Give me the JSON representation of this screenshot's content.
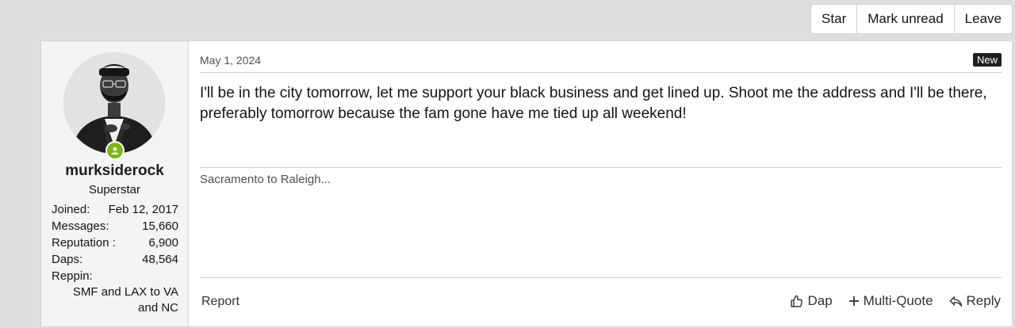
{
  "thread_actions": {
    "star": "Star",
    "mark_unread": "Mark unread",
    "leave": "Leave"
  },
  "user": {
    "username": "murksiderock",
    "title": "Superstar",
    "online": true,
    "stats": [
      {
        "label": "Joined:",
        "value": "Feb 12, 2017"
      },
      {
        "label": "Messages:",
        "value": "15,660"
      },
      {
        "label": "Reputation :",
        "value": "6,900"
      },
      {
        "label": "Daps:",
        "value": "48,564"
      }
    ],
    "reppin_label": "Reppin:",
    "reppin_value": "SMF and LAX to VA and NC"
  },
  "post": {
    "date": "May 1, 2024",
    "badge": "New",
    "message": "I'll be in the city tomorrow, let me support your black business and get lined up. Shoot me the address and I'll be there, preferably tomorrow because the fam gone have me tied up all weekend!",
    "signature": "Sacramento to Raleigh..."
  },
  "footer": {
    "report": "Report",
    "dap": "Dap",
    "multi_quote": "Multi-Quote",
    "reply": "Reply"
  },
  "icons": {
    "dap": "thumbs-up-icon",
    "multi_quote": "plus-icon",
    "reply": "reply-arrow-icon",
    "online": "online-status-icon"
  },
  "colors": {
    "online_green": "#7cb518",
    "badge_bg": "#1f1f1f"
  }
}
